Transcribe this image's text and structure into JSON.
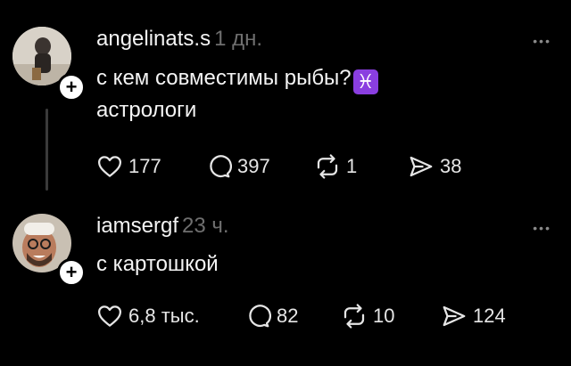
{
  "posts": [
    {
      "username": "angelinats.s",
      "time": "1 дн.",
      "text_line1": "с кем совместимы рыбы?",
      "emoji": "♓",
      "text_line2": "астрологи",
      "likes": "177",
      "comments": "397",
      "reposts": "1",
      "shares": "38",
      "more": "•••"
    },
    {
      "username": "iamsergf",
      "time": "23 ч.",
      "text_line1": "с картошкой",
      "likes": "6,8 тыс.",
      "comments": "82",
      "reposts": "10",
      "shares": "124",
      "more": "•••"
    }
  ],
  "follow_symbol": "+"
}
